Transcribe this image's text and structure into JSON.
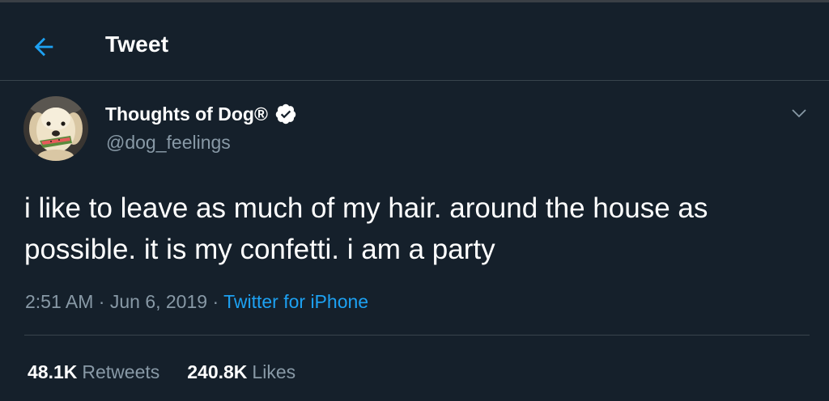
{
  "header": {
    "back_icon": "arrow-left-icon",
    "title": "Tweet"
  },
  "tweet": {
    "author": {
      "display_name": "Thoughts of Dog®",
      "handle": "@dog_feelings",
      "verified": true,
      "verified_icon": "verified-badge-icon",
      "avatar_icon": "dog-avatar"
    },
    "menu_icon": "chevron-down-icon",
    "text": "i like to leave as much of my hair. around the house as possible. it is my confetti. i am a party",
    "time": "2:51 AM",
    "date": "Jun 6, 2019",
    "separator": "·",
    "source": "Twitter for iPhone",
    "stats": {
      "retweets_count": "48.1K",
      "retweets_label": "Retweets",
      "likes_count": "240.8K",
      "likes_label": "Likes"
    }
  },
  "colors": {
    "background": "#15202b",
    "accent": "#1da1f2",
    "muted_text": "#8899a6",
    "border": "#38444d"
  }
}
